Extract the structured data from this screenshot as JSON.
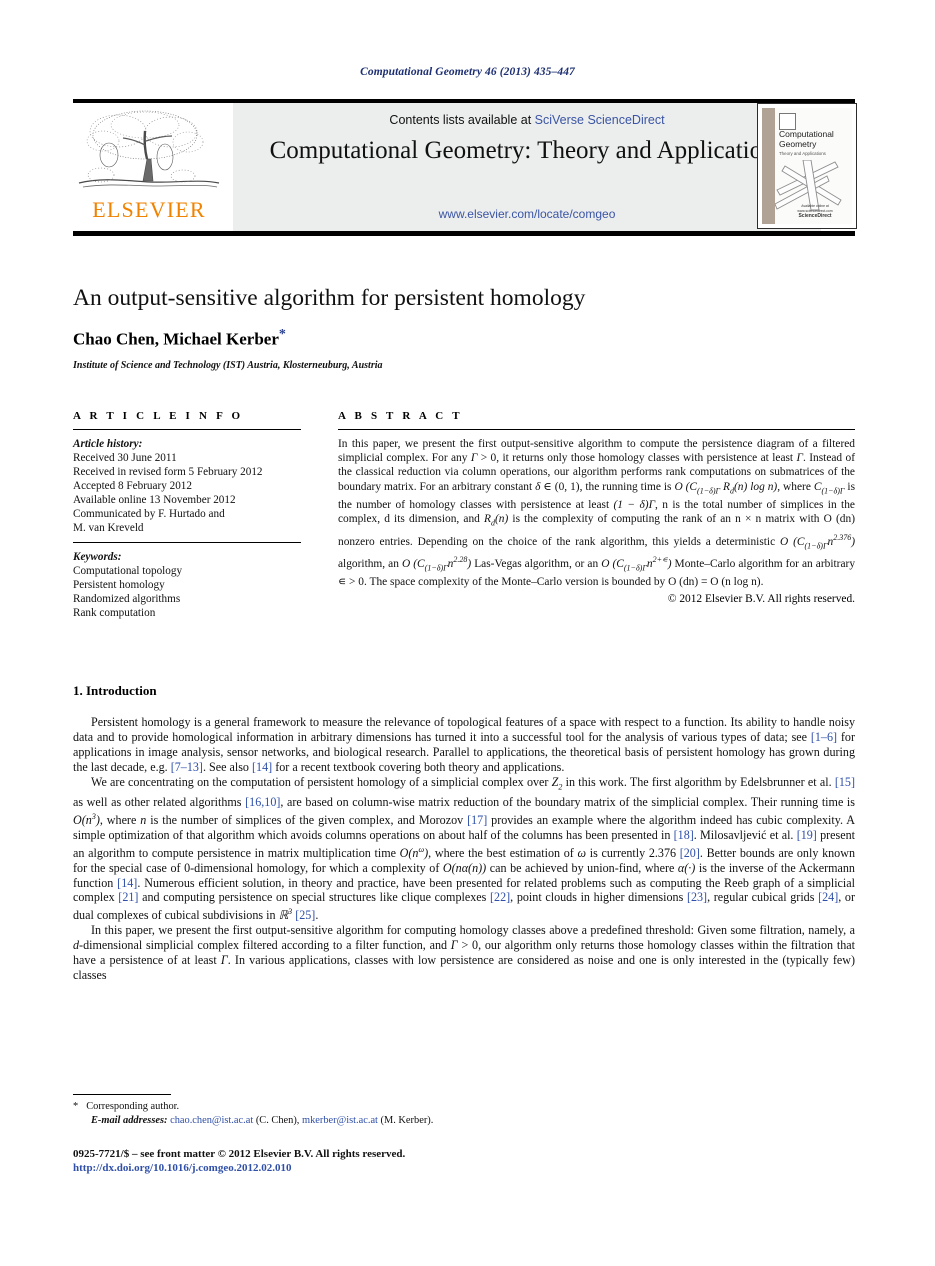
{
  "running_head": "Computational Geometry 46 (2013) 435–447",
  "masthead": {
    "contents_prefix": "Contents lists available at ",
    "contents_link": "SciVerse ScienceDirect",
    "journal_title": "Computational Geometry: Theory and Applications",
    "journal_url": "www.elsevier.com/locate/comgeo",
    "publisher_wordmark": "ELSEVIER",
    "cover": {
      "title": "Computational Geometry",
      "subtitle": "Theory and Applications",
      "footer_top": "Available online at www.sciencedirect.com",
      "footer_brand": "ScienceDirect"
    }
  },
  "article": {
    "title": "An output-sensitive algorithm for persistent homology",
    "authors": "Chao Chen, Michael Kerber",
    "corresponding_marker": "*",
    "affiliation": "Institute of Science and Technology (IST) Austria, Klosterneuburg, Austria"
  },
  "info": {
    "heading": "A R T I C L E   I N F O",
    "history_label": "Article history:",
    "history": [
      "Received 30 June 2011",
      "Received in revised form 5 February 2012",
      "Accepted 8 February 2012",
      "Available online 13 November 2012",
      "Communicated by F. Hurtado and",
      "M. van Kreveld"
    ],
    "keywords_label": "Keywords:",
    "keywords": [
      "Computational topology",
      "Persistent homology",
      "Randomized algorithms",
      "Rank computation"
    ]
  },
  "abstract": {
    "heading": "A B S T R A C T",
    "paragraph_1": "In this paper, we present the first output-sensitive algorithm to compute the persistence diagram of a filtered simplicial complex. For any ",
    "paragraph_2": " > 0, it returns only those homology classes with persistence at least ",
    "paragraph_3": ". Instead of the classical reduction via column operations, our algorithm performs rank computations on submatrices of the boundary matrix. For an arbitrary constant ",
    "paragraph_4": " ∈ (0, 1), the running time is ",
    "paragraph_5": "the number of homology classes with persistence at least ",
    "paragraph_6": ", n is the total number of simplices in the complex, d its dimension, and ",
    "paragraph_7": " is the complexity of computing the rank of an n × n matrix with O (dn) nonzero entries. Depending on the choice of the rank algorithm, this yields a deterministic ",
    "paragraph_8": " algorithm, an ",
    "paragraph_9": " Las-Vegas algorithm, or an ",
    "paragraph_10": " Monte–Carlo algorithm for an arbitrary ∊ > 0. The space complexity of the Monte–Carlo version is bounded by O (dn) = O (n log n).",
    "copyright": "© 2012 Elsevier B.V. All rights reserved."
  },
  "body": {
    "section_number_title": "1. Introduction",
    "paragraph_1": "Persistent homology is a general framework to measure the relevance of topological features of a space with respect to a function. Its ability to handle noisy data and to provide homological information in arbitrary dimensions has turned it into a successful tool for the analysis of various types of data; see [1–6] for applications in image analysis, sensor networks, and biological research. Parallel to applications, the theoretical basis of persistent homology has grown during the last decade, e.g. [7–13]. See also [14] for a recent textbook covering both theory and applications.",
    "paragraph_2": "We are concentrating on the computation of persistent homology of a simplicial complex over Z2 in this work. The first algorithm by Edelsbrunner et al. [15] as well as other related algorithms [16,10], are based on column-wise matrix reduction of the boundary matrix of the simplicial complex. Their running time is O(n3), where n is the number of simplices of the given complex, and Morozov [17] provides an example where the algorithm indeed has cubic complexity. A simple optimization of that algorithm which avoids columns operations on about half of the columns has been presented in [18]. Milosavljević et al. [19] present an algorithm to compute persistence in matrix multiplication time O(nω), where the best estimation of ω is currently 2.376 [20]. Better bounds are only known for the special case of 0-dimensional homology, for which a complexity of O(nα(n)) can be achieved by union-find, where α(·) is the inverse of the Ackermann function [14]. Numerous efficient solution, in theory and practice, have been presented for related problems such as computing the Reeb graph of a simplicial complex [21] and computing persistence on special structures like clique complexes [22], point clouds in higher dimensions [23], regular cubical grids [24], or dual complexes of cubical subdivisions in R3 [25].",
    "paragraph_3": "In this paper, we present the first output-sensitive algorithm for computing homology classes above a predefined threshold: Given some filtration, namely, a d-dimensional simplicial complex filtered according to a filter function, and Γ > 0, our algorithm only returns those homology classes within the filtration that have a persistence of at least Γ. In various applications, classes with low persistence are considered as noise and one is only interested in the (typically few) classes"
  },
  "footer": {
    "corresponding_note": "Corresponding author.",
    "email_label": "E-mail addresses:",
    "email_1": "chao.chen@ist.ac.at",
    "email_1_name": " (C. Chen), ",
    "email_2": "mkerber@ist.ac.at",
    "email_2_name": " (M. Kerber).",
    "issn_line": "0925-7721/$ – see front matter  © 2012 Elsevier B.V. All rights reserved.",
    "doi_line": "http://dx.doi.org/10.1016/j.comgeo.2012.02.010"
  },
  "colors": {
    "link": "#3a55a5",
    "reference": "#2f4fa8",
    "running_head": "#1d2f72",
    "elsevier_orange": "#ef8200",
    "masthead_band": "#eceded"
  }
}
